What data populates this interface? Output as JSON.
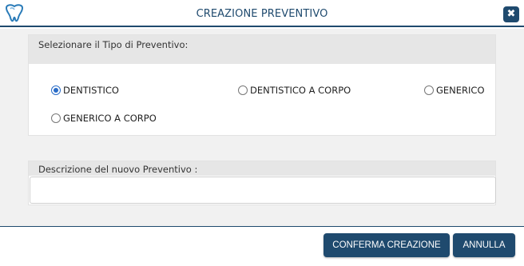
{
  "dialog": {
    "title": "CREAZIONE PREVENTIVO",
    "close_icon": "close-x-icon",
    "logo_icon": "tooth-logo-icon"
  },
  "type_section": {
    "header": "Selezionare il Tipo di Preventivo:",
    "options": [
      {
        "label": "DENTISTICO",
        "checked": true
      },
      {
        "label": "DENTISTICO A CORPO",
        "checked": false
      },
      {
        "label": "GENERICO",
        "checked": false
      },
      {
        "label": "GENERICO A CORPO",
        "checked": false
      }
    ]
  },
  "description_section": {
    "header": "Descrizione del nuovo Preventivo :",
    "value": "",
    "placeholder": ""
  },
  "footer": {
    "confirm_label": "CONFERMA CREAZIONE",
    "cancel_label": "ANNULLA"
  },
  "colors": {
    "primary": "#1f4a6e",
    "radio_selected": "#2a6cc7",
    "background": "#f1f1f1",
    "panel_header": "#e6e6e6"
  }
}
